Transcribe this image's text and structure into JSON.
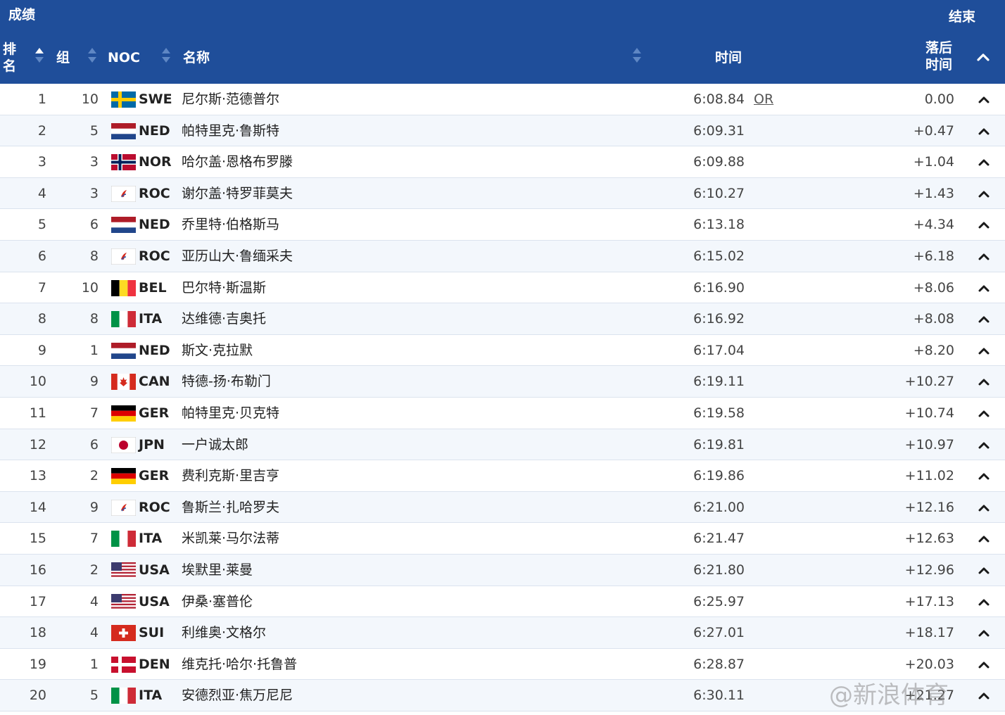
{
  "header": {
    "title": "成绩",
    "status": "结束",
    "columns": {
      "rank": "排名",
      "group": "组",
      "noc": "NOC",
      "name": "名称",
      "time": "时间",
      "behind": "落后时间"
    }
  },
  "colors": {
    "header_bg": "#1f4e9a",
    "row_alt_bg": "#f3f7fc",
    "chevron": "#1a1a1a"
  },
  "rows": [
    {
      "rank": "1",
      "group": "10",
      "flag": "sweden-flag",
      "noc": "SWE",
      "name": "尼尔斯·范德普尔",
      "time": "6:08.84",
      "qual": "OR",
      "behind": "0.00"
    },
    {
      "rank": "2",
      "group": "5",
      "flag": "netherlands-flag",
      "noc": "NED",
      "name": "帕特里克·鲁斯特",
      "time": "6:09.31",
      "qual": "",
      "behind": "+0.47"
    },
    {
      "rank": "3",
      "group": "3",
      "flag": "norway-flag",
      "noc": "NOR",
      "name": "哈尔盖·恩格布罗滕",
      "time": "6:09.88",
      "qual": "",
      "behind": "+1.04"
    },
    {
      "rank": "4",
      "group": "3",
      "flag": "roc-flag",
      "noc": "ROC",
      "name": "谢尔盖·特罗菲莫夫",
      "time": "6:10.27",
      "qual": "",
      "behind": "+1.43"
    },
    {
      "rank": "5",
      "group": "6",
      "flag": "netherlands-flag",
      "noc": "NED",
      "name": "乔里特·伯格斯马",
      "time": "6:13.18",
      "qual": "",
      "behind": "+4.34"
    },
    {
      "rank": "6",
      "group": "8",
      "flag": "roc-flag",
      "noc": "ROC",
      "name": "亚历山大·鲁缅采夫",
      "time": "6:15.02",
      "qual": "",
      "behind": "+6.18"
    },
    {
      "rank": "7",
      "group": "10",
      "flag": "belgium-flag",
      "noc": "BEL",
      "name": "巴尔特·斯温斯",
      "time": "6:16.90",
      "qual": "",
      "behind": "+8.06"
    },
    {
      "rank": "8",
      "group": "8",
      "flag": "italy-flag",
      "noc": "ITA",
      "name": "达维德·吉奥托",
      "time": "6:16.92",
      "qual": "",
      "behind": "+8.08"
    },
    {
      "rank": "9",
      "group": "1",
      "flag": "netherlands-flag",
      "noc": "NED",
      "name": "斯文·克拉默",
      "time": "6:17.04",
      "qual": "",
      "behind": "+8.20"
    },
    {
      "rank": "10",
      "group": "9",
      "flag": "canada-flag",
      "noc": "CAN",
      "name": "特德-扬·布勒门",
      "time": "6:19.11",
      "qual": "",
      "behind": "+10.27"
    },
    {
      "rank": "11",
      "group": "7",
      "flag": "germany-flag",
      "noc": "GER",
      "name": "帕特里克·贝克特",
      "time": "6:19.58",
      "qual": "",
      "behind": "+10.74"
    },
    {
      "rank": "12",
      "group": "6",
      "flag": "japan-flag",
      "noc": "JPN",
      "name": "一户诚太郎",
      "time": "6:19.81",
      "qual": "",
      "behind": "+10.97"
    },
    {
      "rank": "13",
      "group": "2",
      "flag": "germany-flag",
      "noc": "GER",
      "name": "费利克斯·里吉亨",
      "time": "6:19.86",
      "qual": "",
      "behind": "+11.02"
    },
    {
      "rank": "14",
      "group": "9",
      "flag": "roc-flag",
      "noc": "ROC",
      "name": "鲁斯兰·扎哈罗夫",
      "time": "6:21.00",
      "qual": "",
      "behind": "+12.16"
    },
    {
      "rank": "15",
      "group": "7",
      "flag": "italy-flag",
      "noc": "ITA",
      "name": "米凯莱·马尔法蒂",
      "time": "6:21.47",
      "qual": "",
      "behind": "+12.63"
    },
    {
      "rank": "16",
      "group": "2",
      "flag": "usa-flag",
      "noc": "USA",
      "name": "埃默里·莱曼",
      "time": "6:21.80",
      "qual": "",
      "behind": "+12.96"
    },
    {
      "rank": "17",
      "group": "4",
      "flag": "usa-flag",
      "noc": "USA",
      "name": "伊桑·塞普伦",
      "time": "6:25.97",
      "qual": "",
      "behind": "+17.13"
    },
    {
      "rank": "18",
      "group": "4",
      "flag": "switzerland-flag",
      "noc": "SUI",
      "name": "利维奥·文格尔",
      "time": "6:27.01",
      "qual": "",
      "behind": "+18.17"
    },
    {
      "rank": "19",
      "group": "1",
      "flag": "denmark-flag",
      "noc": "DEN",
      "name": "维克托·哈尔·托鲁普",
      "time": "6:28.87",
      "qual": "",
      "behind": "+20.03"
    },
    {
      "rank": "20",
      "group": "5",
      "flag": "italy-flag",
      "noc": "ITA",
      "name": "安德烈亚·焦万尼尼",
      "time": "6:30.11",
      "qual": "",
      "behind": "+21.27"
    }
  ],
  "watermark": "@新浪体育"
}
